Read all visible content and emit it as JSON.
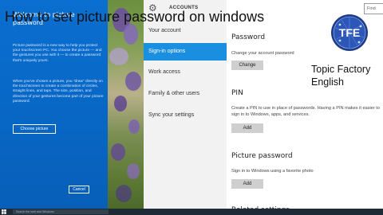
{
  "video": {
    "title": "How to set picture password on windows"
  },
  "picture_password_panel": {
    "title": "Welcome to picture password",
    "description_1": "Picture password is a new way to help you protect your touchscreen PC. You choose the picture — and the gestures you use with it — to create a password that's uniquely yours.",
    "description_2": "When you've chosen a picture, you \"draw\" directly on the touchscreen to create a combination of circles, straight lines, and taps. The size, position, and direction of your gestures become part of your picture password.",
    "choose_picture_label": "Choose picture",
    "cancel_label": "Cancel"
  },
  "settings": {
    "app_title": "ACCOUNTS",
    "search_placeholder": "Find",
    "nav": [
      {
        "label": "Your account",
        "active": false
      },
      {
        "label": "Sign-in options",
        "active": true
      },
      {
        "label": "Work access",
        "active": false
      },
      {
        "label": "Family & other users",
        "active": false
      },
      {
        "label": "Sync your settings",
        "active": false
      }
    ],
    "sections": {
      "password": {
        "heading": "Password",
        "text": "Change your account password",
        "button": "Change"
      },
      "pin": {
        "heading": "PIN",
        "text": "Create a PIN to use in place of passwords. Having a PIN makes it easier to sign in to Windows, apps, and services.",
        "button": "Add"
      },
      "picture_password": {
        "heading": "Picture password",
        "text": "Sign in to Windows using a favorite photo",
        "button": "Add"
      },
      "related": {
        "heading": "Related settings"
      }
    }
  },
  "logo": {
    "text": "TFE",
    "channel_name": "Topic Factory English",
    "colors": {
      "ring": "#1f3c88",
      "inner": "#2c56b8",
      "text": "#ffffff"
    }
  },
  "taskbar": {
    "search_placeholder": "Search the web and Windows"
  },
  "colors": {
    "accent": "#1a8fe0",
    "panel_blue": "#0a6fd0"
  }
}
